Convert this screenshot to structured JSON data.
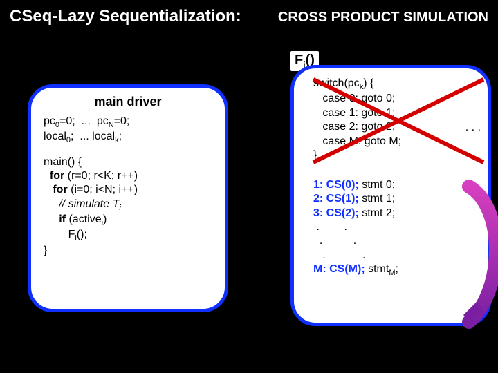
{
  "title_left": "CSeq-Lazy Sequentialization:",
  "title_right": "CROSS PRODUCT SIMULATION",
  "fi_label": "F<sub>i</sub>()",
  "left_header": "main driver",
  "left_decls_html": "pc<sub>0</sub>=0;  ...  pc<sub>N</sub>=0;\nlocal<sub>0</sub>;  ... local<sub>k</sub>;",
  "left_main_html": "main() {\n  <span class=\"kw\">for</span> (r=0; r&lt;K; r++)\n   <span class=\"kw\">for</span> (i=0; i&lt;N; i++)\n     <span class=\"comment\">// simulate T<sub>i</sub></span>\n     <span class=\"kw\">if</span> (active<sub>i</sub>)\n        F<sub>i</sub>();\n}",
  "switch_html": "switch(pc<sub>k</sub>) {\n   case 0: goto 0;\n   case 1: goto 1;\n   case 2: goto 2;\n   case M: goto M;\n}",
  "switch_dots": ". . .",
  "cs_lines": [
    {
      "pre": "1: CS(0);",
      "post": " stmt 0;"
    },
    {
      "pre": "2: CS(1);",
      "post": " stmt 1;"
    },
    {
      "pre": "3: CS(2);",
      "post": " stmt 2;"
    }
  ],
  "cs_dots_html": " .        .\n  .          .\n   .            .",
  "cs_last": {
    "pre": "M: CS(M);",
    "post_html": " stmt<sub>M</sub>;"
  }
}
